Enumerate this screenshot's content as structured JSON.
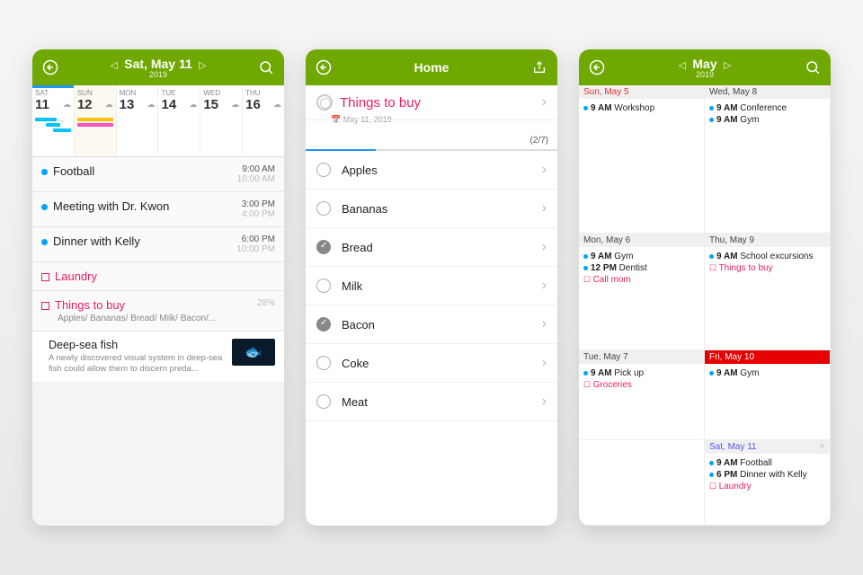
{
  "phone1": {
    "header": {
      "title": "Sat, May 11",
      "sub": "2019"
    },
    "days": [
      {
        "dow": "SAT",
        "num": "11",
        "sel": false,
        "sat": true
      },
      {
        "dow": "SUN",
        "num": "12",
        "sel": true
      },
      {
        "dow": "MON",
        "num": "13"
      },
      {
        "dow": "TUE",
        "num": "14"
      },
      {
        "dow": "WED",
        "num": "15"
      },
      {
        "dow": "THU",
        "num": "16"
      }
    ],
    "events": [
      {
        "title": "Football",
        "start": "9:00 AM",
        "end": "10:00 AM"
      },
      {
        "title": "Meeting with Dr. Kwon",
        "start": "3:00 PM",
        "end": "4:00 PM"
      },
      {
        "title": "Dinner with Kelly",
        "start": "6:00 PM",
        "end": "10:00 PM"
      }
    ],
    "tasks": [
      {
        "title": "Laundry"
      },
      {
        "title": "Things to buy",
        "sub": "Apples/ Bananas/ Bread/ Milk/ Bacon/...",
        "pct": "28%"
      }
    ],
    "article": {
      "title": "Deep-sea fish",
      "desc": "A newly discovered visual system in deep-sea fish could allow them to discern preda..."
    }
  },
  "phone2": {
    "header": {
      "title": "Home"
    },
    "list_title": "Things to buy",
    "list_date": "May 11, 2019",
    "progress": "(2/7)",
    "progress_pct": 28,
    "items": [
      {
        "label": "Apples",
        "done": false
      },
      {
        "label": "Bananas",
        "done": false
      },
      {
        "label": "Bread",
        "done": true
      },
      {
        "label": "Milk",
        "done": false
      },
      {
        "label": "Bacon",
        "done": true
      },
      {
        "label": "Coke",
        "done": false
      },
      {
        "label": "Meat",
        "done": false
      }
    ]
  },
  "phone3": {
    "header": {
      "title": "May",
      "sub": "2019"
    },
    "cells": [
      {
        "head": "Sun, May 5",
        "cls": "sun",
        "events": [
          {
            "t": "9 AM",
            "txt": "Workshop"
          }
        ]
      },
      {
        "head": "Wed, May 8",
        "events": [
          {
            "t": "9 AM",
            "txt": "Conference"
          },
          {
            "t": "9 AM",
            "txt": "Gym"
          }
        ]
      },
      {
        "head": "Mon, May 6",
        "events": [
          {
            "t": "9 AM",
            "txt": "Gym"
          },
          {
            "t": "12 PM",
            "txt": "Dentist"
          },
          {
            "reminder": true,
            "txt": "Call mom"
          }
        ]
      },
      {
        "head": "Thu, May 9",
        "events": [
          {
            "t": "9 AM",
            "txt": "School excursions"
          },
          {
            "reminder": true,
            "txt": "Things to buy"
          }
        ]
      },
      {
        "head": "Tue, May 7",
        "events": [
          {
            "t": "9 AM",
            "txt": "Pick up"
          },
          {
            "reminder": true,
            "txt": "Groceries"
          }
        ]
      },
      {
        "head": "Fri, May 10",
        "cls": "today",
        "events": [
          {
            "t": "9 AM",
            "txt": "Gym"
          }
        ]
      },
      {
        "head": "",
        "blank": true
      },
      {
        "head": "Sat, May 11",
        "cls": "sat",
        "weather": true,
        "events": [
          {
            "t": "9 AM",
            "txt": "Football"
          },
          {
            "t": "6 PM",
            "txt": "Dinner with Kelly"
          },
          {
            "reminder": true,
            "txt": "Laundry"
          }
        ]
      }
    ]
  }
}
